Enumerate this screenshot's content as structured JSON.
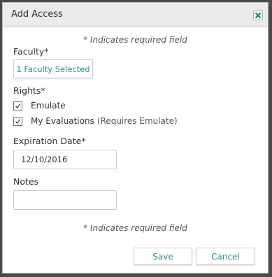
{
  "dialog": {
    "title": "Add Access",
    "close_icon": "close-icon",
    "accent_color": "#2a8c8c",
    "close_color": "#1f7a7a"
  },
  "required_note": "* Indicates required field",
  "faculty": {
    "label": "Faculty*",
    "button_label": "1 Faculty Selected"
  },
  "rights": {
    "label": "Rights*",
    "options": [
      {
        "label": "Emulate",
        "hint": "",
        "checked": true
      },
      {
        "label": "My Evaluations",
        "hint": "(Requires Emulate)",
        "checked": true
      }
    ]
  },
  "expiration": {
    "label": "Expiration Date*",
    "value": "12/10/2016"
  },
  "notes": {
    "label": "Notes",
    "value": ""
  },
  "footer": {
    "required_note": "* Indicates required field",
    "save_label": "Save",
    "cancel_label": "Cancel"
  }
}
